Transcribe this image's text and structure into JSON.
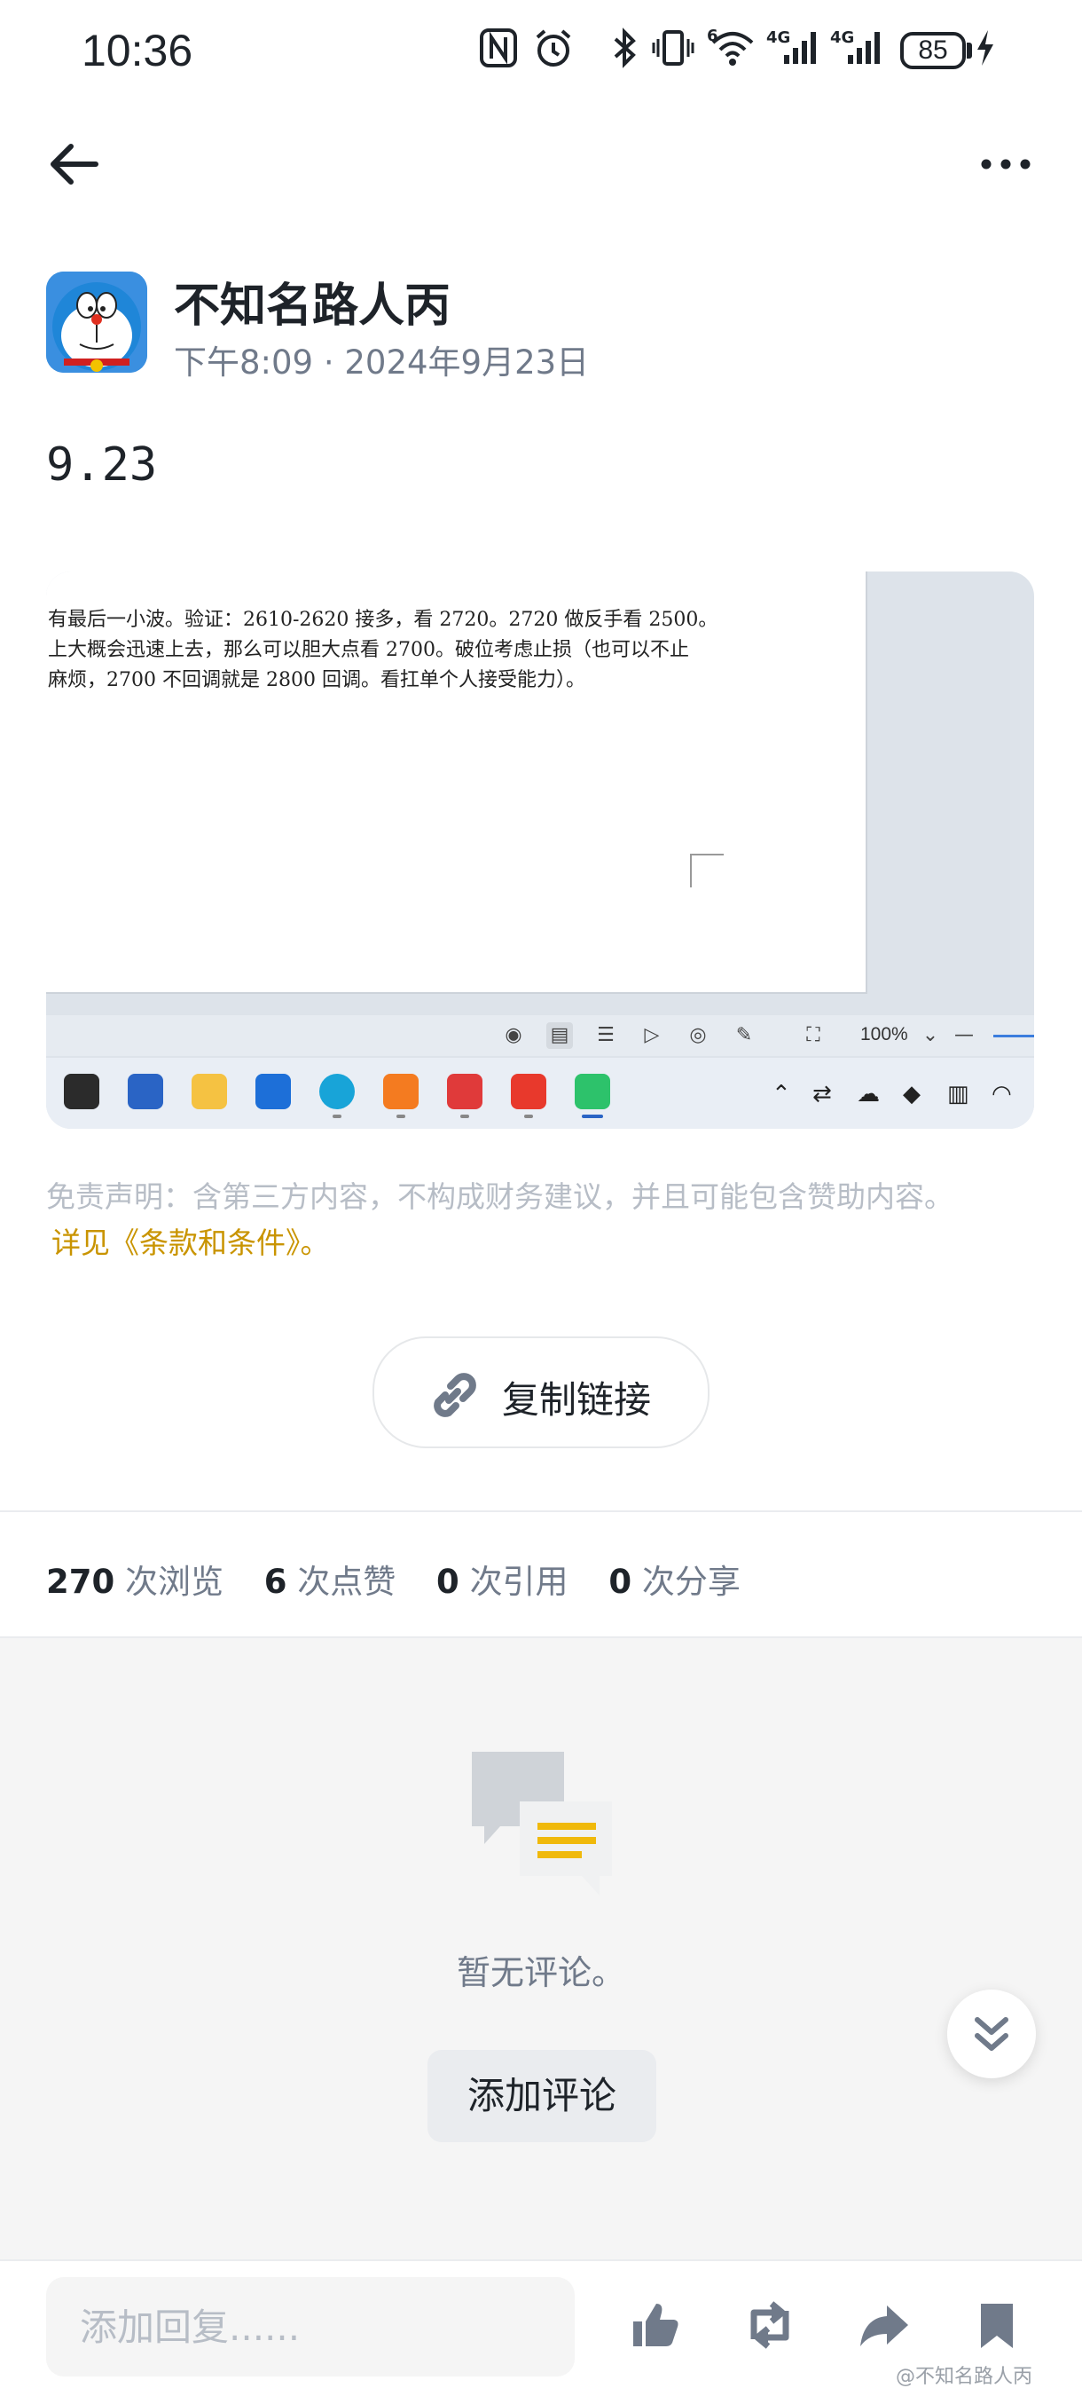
{
  "status_bar": {
    "time": "10:36",
    "network_1": "4G",
    "network_2": "4G",
    "wifi_badge": "6",
    "battery": "85"
  },
  "header": {
    "back_icon": "arrow-left-icon",
    "more_icon": "more-horizontal-icon"
  },
  "post": {
    "author": "不知名路人丙",
    "time": "下午8:09",
    "date": "2024年9月23日",
    "title": "9.23",
    "image": {
      "lines": [
        "有最后一小波。验证：2610-2620 接多，看 2720。2720 做反手看 2500。",
        "上大概会迅速上去，那么可以胆大点看 2700。破位考虑止损（也可以不止",
        "麻烦，2700 不回调就是 2800 回调。看扛单个人接受能力）。"
      ],
      "zoom": "100%"
    },
    "disclaimer": "免责声明：含第三方内容，不构成财务建议，并且可能包含赞助内容。",
    "terms_link": "详见《条款和条件》。",
    "copy_link": "复制链接"
  },
  "stats": {
    "views_num": "270",
    "views_label": "次浏览",
    "likes_num": "6",
    "likes_label": "次点赞",
    "quotes_num": "0",
    "quotes_label": "次引用",
    "shares_num": "0",
    "shares_label": "次分享"
  },
  "comments": {
    "empty_text": "暂无评论。",
    "add_button": "添加评论"
  },
  "bottom_bar": {
    "reply_placeholder": "添加回复......",
    "watermark": "@不知名路人丙"
  },
  "colors": {
    "accent": "#c99400",
    "text_primary": "#1e2329",
    "text_secondary": "#707a8a",
    "comment_icon_yellow": "#f0b90b"
  }
}
